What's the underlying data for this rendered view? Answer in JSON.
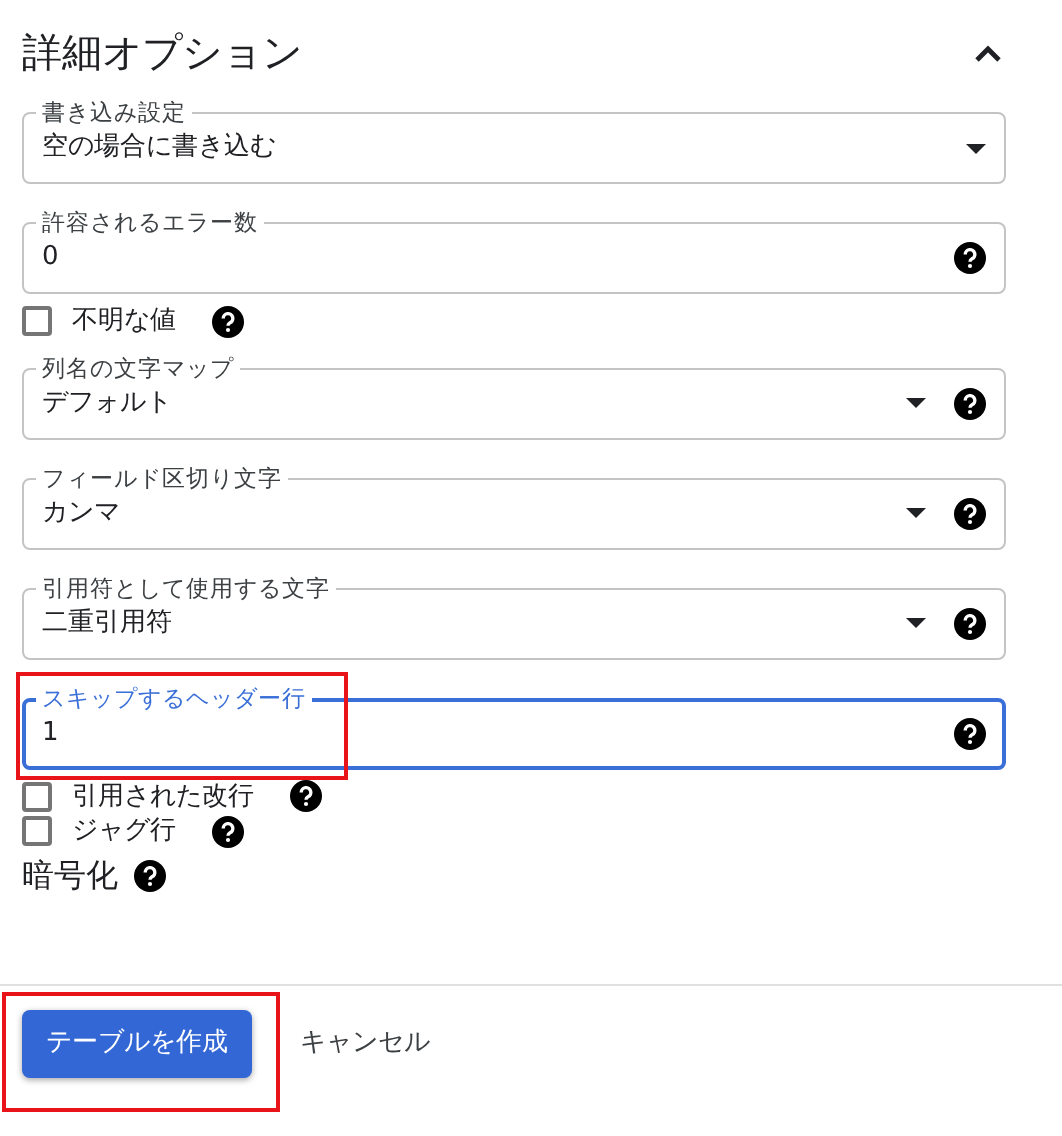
{
  "section": {
    "title": "詳細オプション",
    "expanded": true
  },
  "options": [
    {
      "kind": "select",
      "label": "書き込み設定",
      "value": "空の場合に書き込む",
      "help": false,
      "focused": false,
      "highlighted": false
    },
    {
      "kind": "text",
      "label": "許容されるエラー数",
      "value": "0",
      "help": true,
      "focused": false,
      "highlighted": false
    },
    {
      "kind": "checkbox",
      "label": "不明な値",
      "checked": false,
      "help": true
    },
    {
      "kind": "select",
      "label": "列名の文字マップ",
      "value": "デフォルト",
      "help": true,
      "focused": false,
      "highlighted": false
    },
    {
      "kind": "select",
      "label": "フィールド区切り文字",
      "value": "カンマ",
      "help": true,
      "focused": false,
      "highlighted": false
    },
    {
      "kind": "select",
      "label": "引用符として使用する文字",
      "value": "二重引用符",
      "help": true,
      "focused": false,
      "highlighted": false
    },
    {
      "kind": "text",
      "label": "スキップするヘッダー行",
      "value": "1",
      "help": true,
      "focused": true,
      "highlighted": true
    },
    {
      "kind": "checkbox",
      "label": "引用された改行",
      "checked": false,
      "help": true
    },
    {
      "kind": "checkbox",
      "label": "ジャグ行",
      "checked": false,
      "help": true
    },
    {
      "kind": "heading",
      "label": "暗号化",
      "help": true
    }
  ],
  "footer": {
    "buttons": [
      {
        "kind": "primary",
        "label": "テーブルを作成",
        "highlighted": true
      },
      {
        "kind": "text",
        "label": "キャンセル",
        "highlighted": false
      }
    ]
  }
}
